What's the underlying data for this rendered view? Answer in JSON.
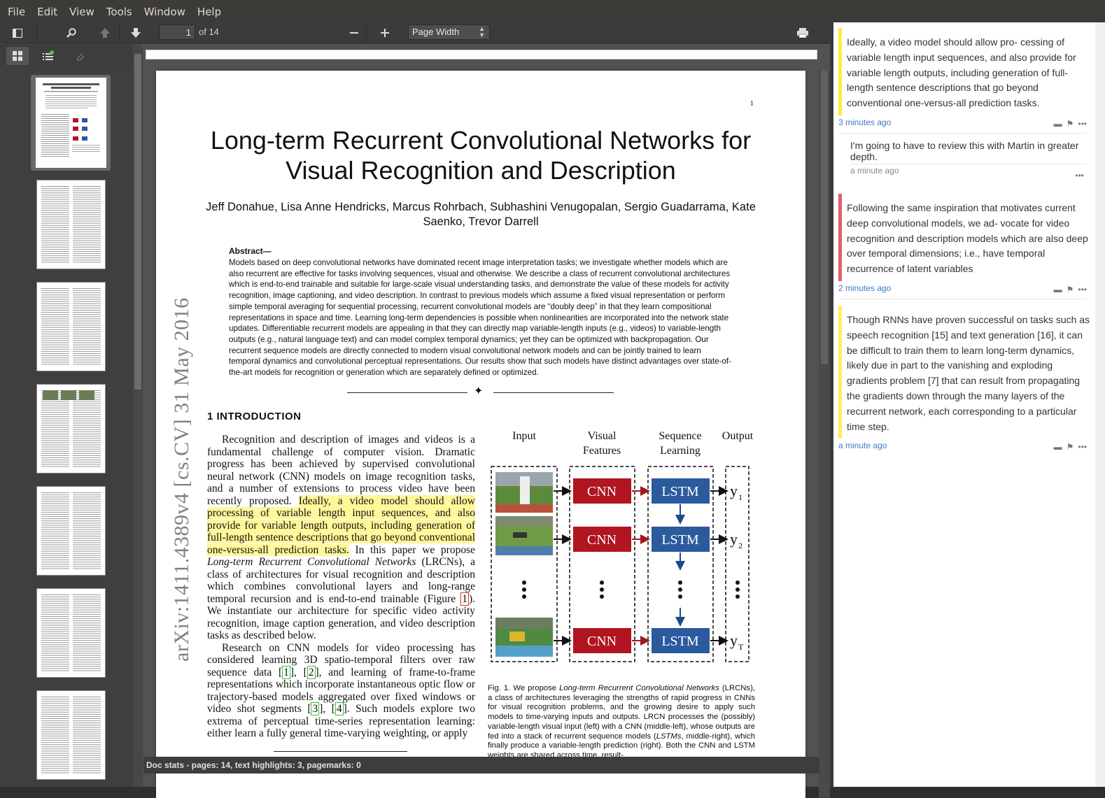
{
  "menu": [
    "File",
    "Edit",
    "View",
    "Tools",
    "Window",
    "Help"
  ],
  "toolbar": {
    "page_current": "1",
    "page_of": "of 14",
    "zoom": "Page Width"
  },
  "status": "Doc stats - pages: 14, text highlights: 3, pagemarks: 0",
  "paper": {
    "page_number": "1",
    "title": "Long-term Recurrent Convolutional Networks for Visual Recognition and Description",
    "authors": "Jeff Donahue, Lisa Anne Hendricks, Marcus Rohrbach, Subhashini Venugopalan, Sergio Guadarrama, Kate Saenko, Trevor Darrell",
    "abstract_head": "Abstract—",
    "abstract": "Models based on deep convolutional networks have dominated recent image interpretation tasks; we investigate whether models which are also recurrent are effective for tasks involving sequences, visual and otherwise. We describe a class of recurrent convolutional architectures which is end-to-end trainable and suitable for large-scale visual understanding tasks, and demonstrate the value of these models for activity recognition, image captioning, and video description. In contrast to previous models which assume a fixed visual representation or perform simple temporal averaging for sequential processing, recurrent convolutional models are “doubly deep” in that they learn compositional representations in space and time. Learning long-term dependencies is possible when nonlinearities are incorporated into the network state updates. Differentiable recurrent models are appealing in that they can directly map variable-length inputs (e.g., videos) to variable-length outputs (e.g., natural language text) and can model complex temporal dynamics; yet they can be optimized with backpropagation. Our recurrent sequence models are directly connected to modern visual convolutional network models and can be jointly trained to learn temporal dynamics and convolutional perceptual representations. Our results show that such models have distinct advantages over state-of-the-art models for recognition or generation which are separately defined or optimized.",
    "section": "1  INTRODUCTION",
    "para1_a": "Recognition and description of images and videos is a fundamental challenge of computer vision. Dramatic progress has been achieved by supervised convolutional neural network (CNN) models on image recognition tasks, and a number of extensions to process video have been recently proposed. ",
    "para1_hl": "Ideally, a video model should allow processing of variable length input sequences, and also provide for variable length outputs, including generation of full-length sentence descriptions that go beyond conventional one-versus-all prediction tasks.",
    "para1_b": " In this paper we propose ",
    "para1_em": "Long-term Recurrent Convolutional Networks",
    "para1_c": " (LRCNs), a class of architectures for visual recognition and description which combines convolutional layers and long-range temporal recursion and is end-to-end trainable (Figure ",
    "para1_ref": "1",
    "para1_d": "). We instantiate our architecture for specific video activity recognition, image caption generation, and video description tasks as described below.",
    "para2_a": "Research on CNN models for video processing has considered learning 3D spatio-temporal filters over raw sequence data [",
    "ref1": "1",
    "para2_b": "], [",
    "ref2": "2",
    "para2_c": "], and learning of frame-to-frame representations which incorporate instantaneous optic flow or trajectory-based models aggregated over fixed windows or video shot segments [",
    "ref3": "3",
    "para2_d": "], [",
    "ref4": "4",
    "para2_e": "]. Such models explore two extrema of perceptual time-series representation learning: either learn a fully general time-varying weighting, or apply",
    "arxiv": "arXiv:1411.4389v4  [cs.CV]  31 May 2016",
    "figure": {
      "col_input": "Input",
      "col_visual": "Visual",
      "col_visual2": "Features",
      "col_seq": "Sequence",
      "col_seq2": "Learning",
      "col_output": "Output",
      "cnn": "CNN",
      "lstm": "LSTM",
      "y1": "y",
      "y1sub": "1",
      "y2": "y",
      "y2sub": "2",
      "yT": "y",
      "yTsub": "T",
      "colors": {
        "cnn": "#b01520",
        "lstm": "#2b5a9e",
        "arrow_red": "#9e1a1f",
        "arrow_blue": "#1c4a86"
      }
    },
    "caption_a": "Fig. 1.  We propose ",
    "caption_em": "Long-term Recurrent Convolutional Networks",
    "caption_b": " (LRCNs), a class of architectures leveraging the strengths of rapid progress in CNNs for visual recognition problems, and the growing desire to apply such models to time-varying inputs and outputs. LRCN processes the (possibly) variable-length visual input (left) with a CNN (middle-left), whose outputs are fed into a stack of recurrent sequence models (",
    "caption_em2": "LSTMs",
    "caption_c": ", middle-right), which finally produce a variable-length prediction (right). Both the CNN and LSTM weights are shared across time, result-"
  },
  "annotations": [
    {
      "quote": "Ideally, a video model should allow pro- cessing of variable length input sequences, and also provide for variable length outputs, including generation of full- length sentence descriptions that go beyond conventional one-versus-all prediction tasks.",
      "time": "3 minutes ago",
      "color": "#ffeb3b",
      "reply": "I'm going to have to review this with Martin in greater depth.",
      "reply_time": "a minute ago"
    },
    {
      "quote": "Following the same inspiration that motivates current deep convolutional models, we ad- vocate for video recognition and description models which are also deep over temporal dimensions; i.e., have temporal recurrence of latent variables",
      "time": "2 minutes ago",
      "color": "#e0606a"
    },
    {
      "quote": "Though RNNs have proven successful on tasks such as speech recognition [15] and text generation [16], it can be difficult to train them to learn long-term dynamics, likely due in part to the vanishing and exploding gradients problem [7] that can result from propagating the gradients down through the many layers of the recurrent network, each corresponding to a particular time step.",
      "time": "a minute ago",
      "color": "#ffee58"
    }
  ],
  "icons": [
    "sidebar-toggle-icon",
    "search-icon",
    "arrow-up-icon",
    "arrow-down-icon",
    "minus-icon",
    "plus-icon",
    "print-icon",
    "thumbnails-icon",
    "outline-icon",
    "attachment-icon",
    "comment-icon",
    "flag-icon",
    "more-icon"
  ]
}
